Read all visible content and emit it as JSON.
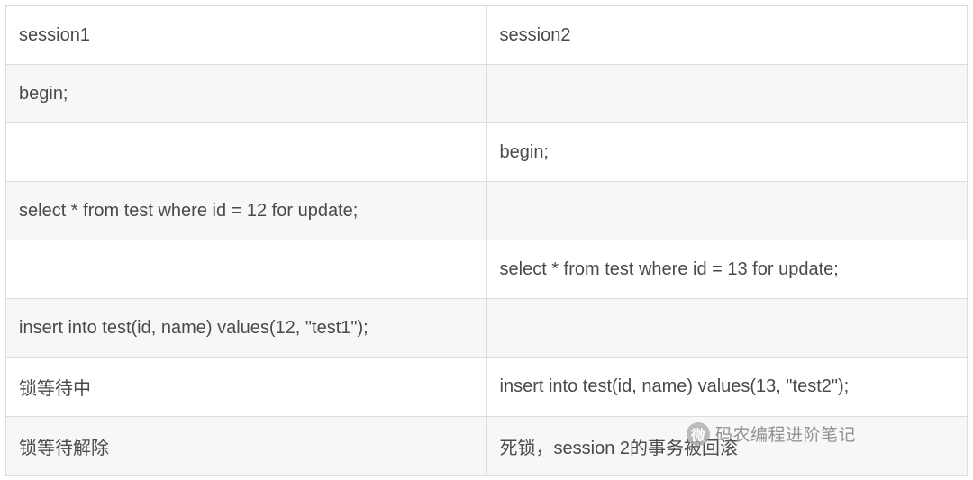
{
  "table": {
    "rows": [
      {
        "c1": "session1",
        "c2": "session2"
      },
      {
        "c1": "begin;",
        "c2": ""
      },
      {
        "c1": "",
        "c2": "begin;"
      },
      {
        "c1": "select * from test where id = 12 for update;",
        "c2": ""
      },
      {
        "c1": "",
        "c2": "select * from test where id = 13 for update;"
      },
      {
        "c1": "insert into test(id, name) values(12, \"test1\");",
        "c2": ""
      },
      {
        "c1": "锁等待中",
        "c2": "insert into test(id, name) values(13, \"test2\");"
      },
      {
        "c1": "锁等待解除",
        "c2": "死锁，session 2的事务被回滚"
      }
    ]
  },
  "watermark": {
    "icon_label": "微",
    "text": "码农编程进阶笔记"
  }
}
